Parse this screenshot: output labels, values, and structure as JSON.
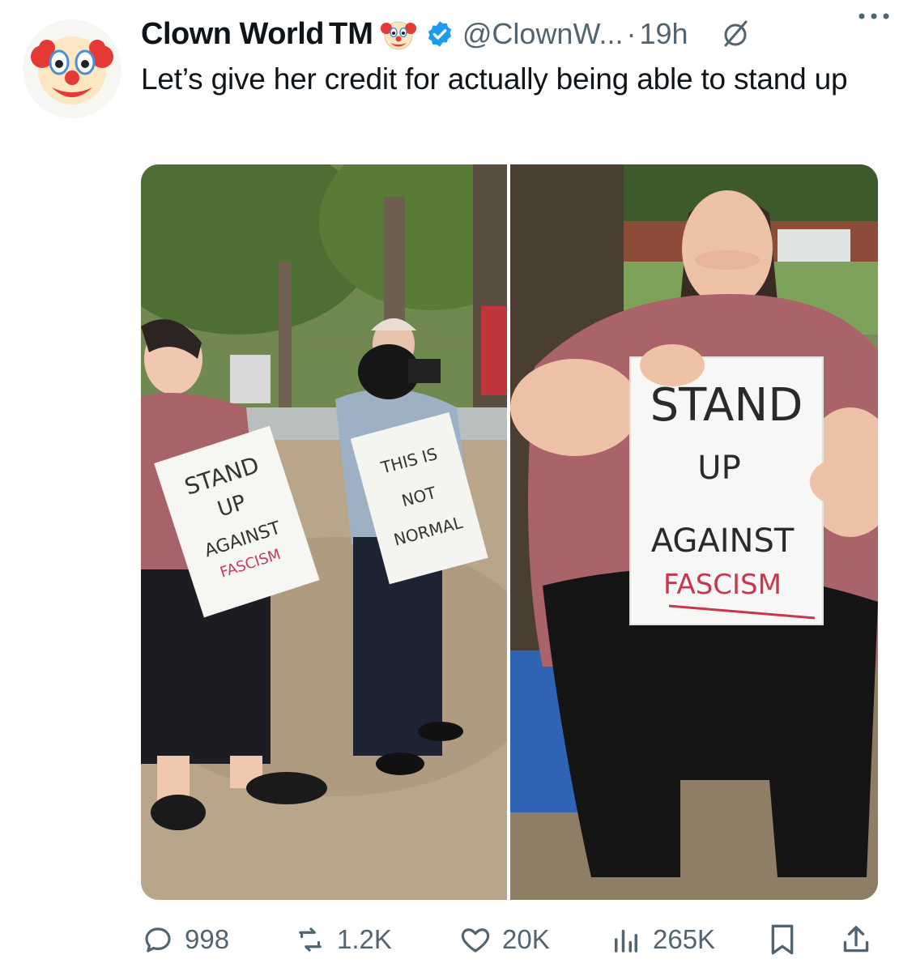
{
  "author": {
    "name": "Clown World",
    "trademark": "TM",
    "handle": "@ClownW...",
    "separator": "·",
    "time": "19h",
    "avatar_icon": "clown-face-icon",
    "verified_color": "#1d9bf0"
  },
  "tweet": {
    "text": "Let’s give her credit for actually being able to stand up"
  },
  "media": {
    "left_photo": {
      "sign_left_lines": [
        "STAND",
        "UP",
        "AGAINST",
        "FASCISM"
      ],
      "sign_right_lines": [
        "THIS IS",
        "NOT",
        "NORMAL"
      ]
    },
    "right_photo": {
      "sign_lines": [
        "STAND",
        "UP",
        "AGAINST"
      ],
      "sign_red_line": "FASCISM"
    }
  },
  "actions": {
    "replies": "998",
    "reposts": "1.2K",
    "likes": "20K",
    "views": "265K"
  }
}
